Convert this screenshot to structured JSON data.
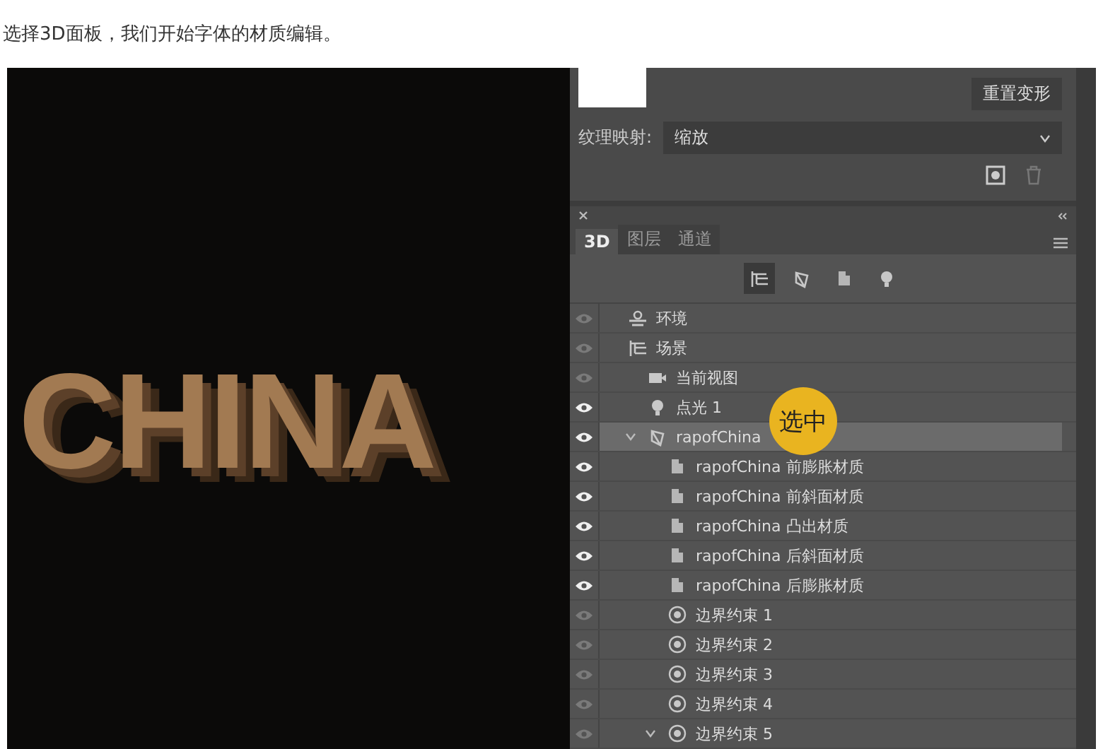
{
  "caption": "选择3D面板，我们开始字体的材质编辑。",
  "canvas": {
    "text": "CHINA"
  },
  "properties": {
    "reset_button": "重置变形",
    "texture_label": "纹理映射:",
    "texture_value": "缩放"
  },
  "panel": {
    "tabs": [
      {
        "label": "3D",
        "selected": true
      },
      {
        "label": "图层",
        "selected": false
      },
      {
        "label": "通道",
        "selected": false
      }
    ],
    "filters": [
      {
        "kind": "scene",
        "selected": true
      },
      {
        "kind": "mesh",
        "selected": false
      },
      {
        "kind": "material",
        "selected": false
      },
      {
        "kind": "light",
        "selected": false
      }
    ],
    "tree": [
      {
        "label": "环境",
        "kind": "environment",
        "visible": false,
        "selected": false
      },
      {
        "label": "场景",
        "kind": "scene",
        "visible": false,
        "selected": false,
        "children": [
          {
            "label": "当前视图",
            "kind": "camera",
            "visible": false,
            "selected": false
          },
          {
            "label": "点光 1",
            "kind": "light",
            "visible": true,
            "selected": false
          },
          {
            "label": "rapofChina",
            "kind": "mesh",
            "visible": true,
            "selected": true,
            "expanded": true,
            "children": [
              {
                "label": "rapofChina 前膨胀材质",
                "kind": "material",
                "visible": true,
                "selected": false
              },
              {
                "label": "rapofChina 前斜面材质",
                "kind": "material",
                "visible": true,
                "selected": false
              },
              {
                "label": "rapofChina 凸出材质",
                "kind": "material",
                "visible": true,
                "selected": false
              },
              {
                "label": "rapofChina 后斜面材质",
                "kind": "material",
                "visible": true,
                "selected": false
              },
              {
                "label": "rapofChina 后膨胀材质",
                "kind": "material",
                "visible": true,
                "selected": false
              },
              {
                "label": "边界约束 1",
                "kind": "constraint",
                "visible": false,
                "selected": false
              },
              {
                "label": "边界约束 2",
                "kind": "constraint",
                "visible": false,
                "selected": false
              },
              {
                "label": "边界约束 3",
                "kind": "constraint",
                "visible": false,
                "selected": false
              },
              {
                "label": "边界约束 4",
                "kind": "constraint",
                "visible": false,
                "selected": false
              },
              {
                "label": "边界约束 5",
                "kind": "constraint",
                "visible": false,
                "selected": false,
                "expanded": true
              }
            ]
          }
        ]
      }
    ]
  },
  "callout": {
    "text": "选中"
  }
}
